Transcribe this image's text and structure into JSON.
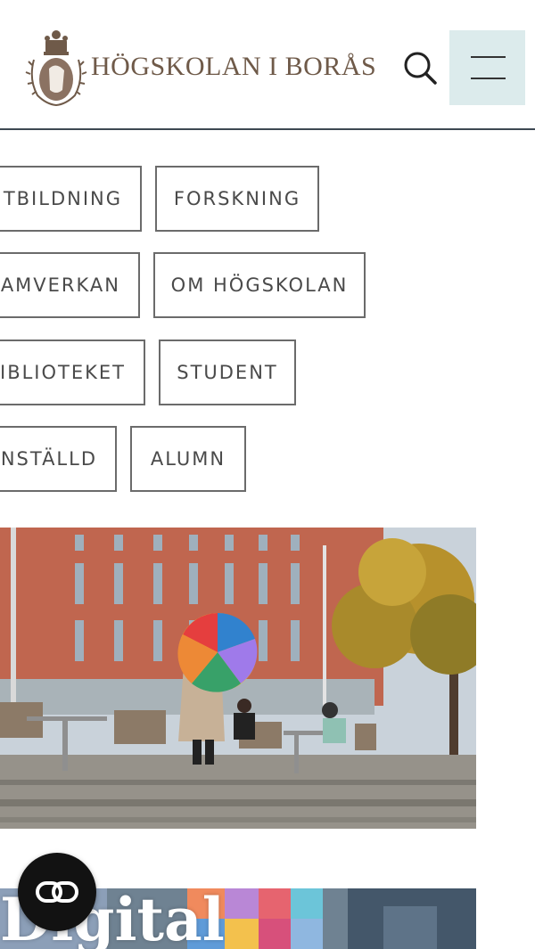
{
  "header": {
    "logo_text": "HÖGSKOLAN I BORÅS",
    "search_icon": "search-icon",
    "menu_icon": "menu-icon"
  },
  "nav": {
    "items": [
      {
        "label": "TBILDNING"
      },
      {
        "label": "FORSKNING"
      },
      {
        "label": "AMVERKAN"
      },
      {
        "label": "OM HÖGSKOLAN"
      },
      {
        "label": "IBLIOTEKET"
      },
      {
        "label": "STUDENT"
      },
      {
        "label": "NSTÄLLD"
      },
      {
        "label": "ALUMN"
      }
    ]
  },
  "promo": {
    "text": "Digital"
  },
  "fab": {
    "icon": "link-icon"
  },
  "colors": {
    "header_border": "#3d4852",
    "menu_bg": "#dcebec",
    "logo_text": "#6f5a49",
    "nav_border": "#6b6b6b",
    "nav_text": "#4a4a4a"
  }
}
